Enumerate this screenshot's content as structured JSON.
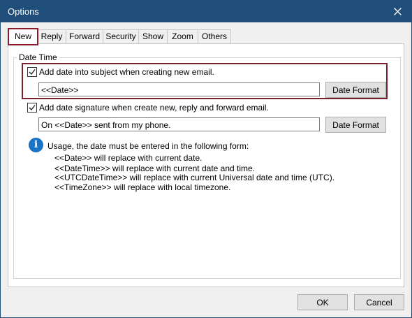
{
  "window": {
    "title": "Options",
    "close_glyph": "✕"
  },
  "tabs": [
    {
      "label": "New",
      "active": true
    },
    {
      "label": "Reply"
    },
    {
      "label": "Forward"
    },
    {
      "label": "Security"
    },
    {
      "label": "Show"
    },
    {
      "label": "Zoom"
    },
    {
      "label": "Others"
    }
  ],
  "group": {
    "label": "Date Time"
  },
  "subject_option": {
    "checked": true,
    "label": "Add date into subject when creating new email.",
    "input_value": "<<Date>>",
    "format_button": "Date Format"
  },
  "signature_option": {
    "checked": true,
    "label": "Add date signature when create new, reply and forward email.",
    "input_value": "On <<Date>> sent from my phone.",
    "format_button": "Date Format"
  },
  "usage": {
    "icon": "i",
    "heading": "Usage, the date must be entered in the following form:",
    "lines": [
      "<<Date>> will replace with current date.",
      "<<DateTime>> will replace with current date and time.",
      "<<UTCDateTime>> will replace with current Universal date and time (UTC).",
      "<<TimeZone>> will replace with local timezone."
    ]
  },
  "footer": {
    "ok_label": "OK",
    "cancel_label": "Cancel"
  },
  "colors": {
    "titlebar": "#1e4e79",
    "highlight": "#7a1f2e",
    "info_icon": "#1a73c9"
  }
}
